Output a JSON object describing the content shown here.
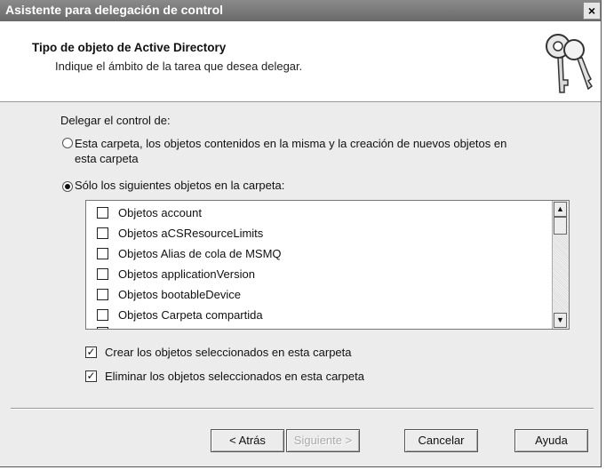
{
  "window": {
    "title": "Asistente para delegación de control",
    "close": "×"
  },
  "header": {
    "title": "Tipo de objeto de Active Directory",
    "subtitle": "Indique el ámbito de la tarea que desea delegar."
  },
  "delegate": {
    "label": "Delegar el control de:",
    "option1": {
      "line1": "Esta carpeta, los objetos contenidos en la misma y la creación de nuevos objetos en",
      "line2": "esta carpeta",
      "selected": false
    },
    "option2": {
      "label": "Sólo los siguientes objetos en la carpeta:",
      "selected": true
    }
  },
  "object_list": {
    "items": [
      {
        "label": "Objetos account",
        "checked": false
      },
      {
        "label": "Objetos aCSResourceLimits",
        "checked": false
      },
      {
        "label": "Objetos Alias de cola de MSMQ",
        "checked": false
      },
      {
        "label": "Objetos applicationVersion",
        "checked": false
      },
      {
        "label": "Objetos bootableDevice",
        "checked": false
      },
      {
        "label": "Objetos Carpeta compartida",
        "checked": false
      }
    ],
    "scroll_up": "▲",
    "scroll_down": "▼"
  },
  "options": {
    "create": {
      "label": "Crear los objetos seleccionados en esta carpeta",
      "checked": true
    },
    "delete": {
      "label": "Eliminar los objetos seleccionados en esta carpeta",
      "checked": true
    },
    "check_mark": "✓"
  },
  "buttons": {
    "back": "< Atrás",
    "next": "Siguiente >",
    "cancel": "Cancelar",
    "help": "Ayuda"
  }
}
